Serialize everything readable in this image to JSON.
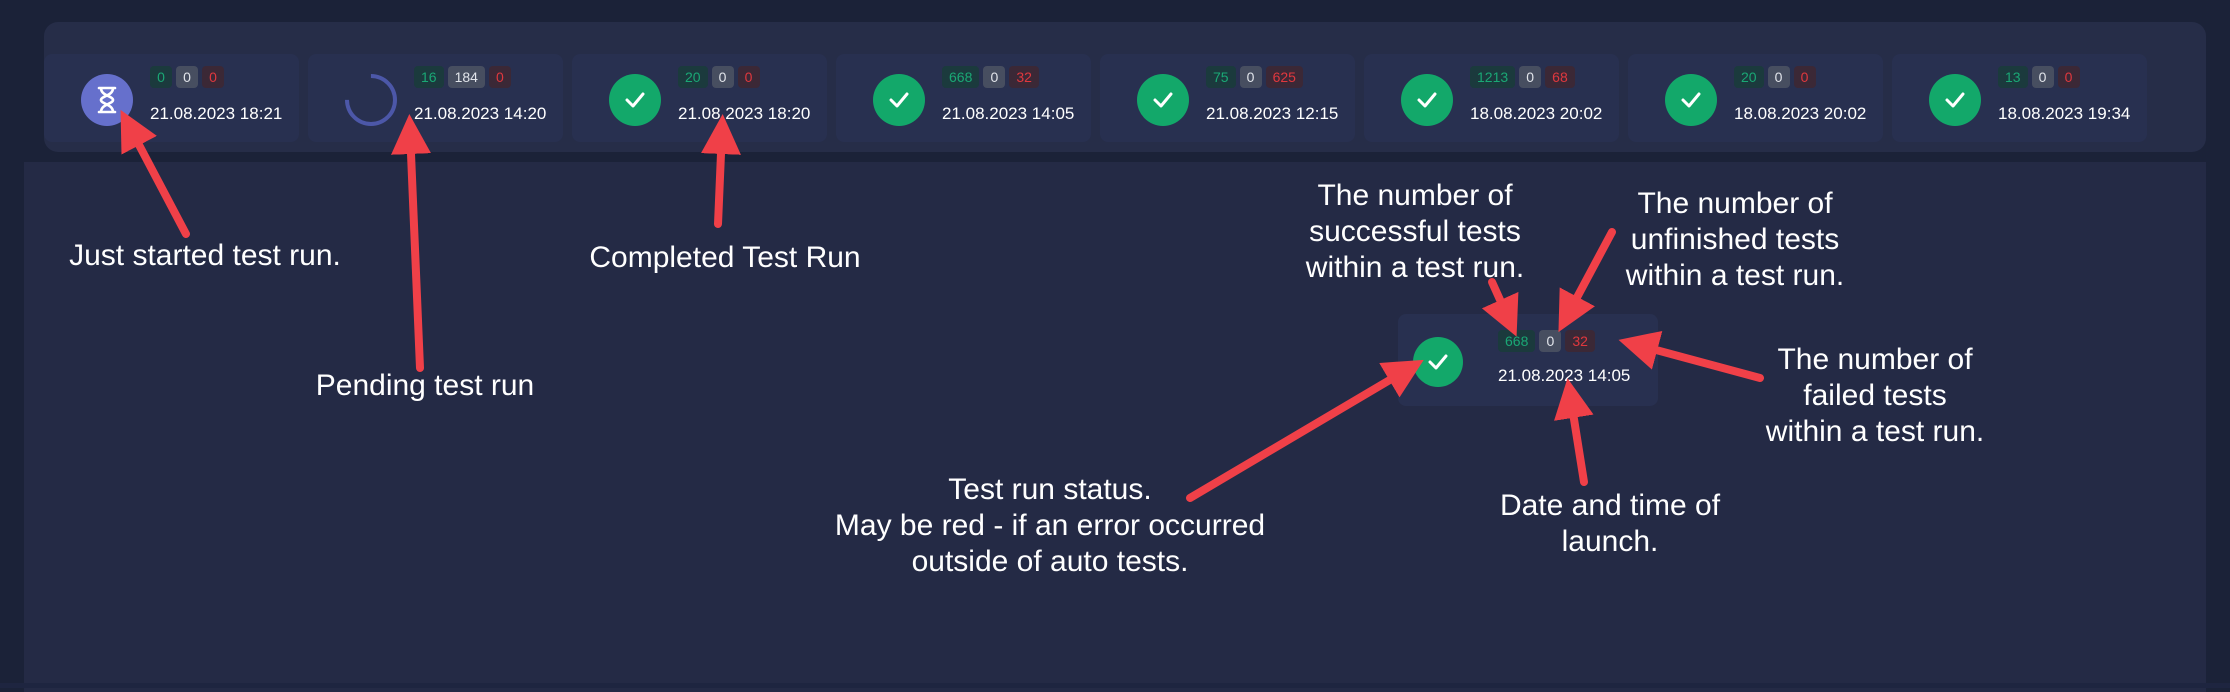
{
  "runs": [
    {
      "status": "started",
      "success": "0",
      "unfinished": "0",
      "failed": "0",
      "date": "21.08.2023 18:21"
    },
    {
      "status": "pending",
      "success": "16",
      "unfinished": "184",
      "failed": "0",
      "date": "21.08.2023 14:20"
    },
    {
      "status": "done",
      "success": "20",
      "unfinished": "0",
      "failed": "0",
      "date": "21.08.2023 18:20"
    },
    {
      "status": "done",
      "success": "668",
      "unfinished": "0",
      "failed": "32",
      "date": "21.08.2023 14:05"
    },
    {
      "status": "done",
      "success": "75",
      "unfinished": "0",
      "failed": "625",
      "date": "21.08.2023 12:15"
    },
    {
      "status": "done",
      "success": "1213",
      "unfinished": "0",
      "failed": "68",
      "date": "18.08.2023 20:02"
    },
    {
      "status": "done",
      "success": "20",
      "unfinished": "0",
      "failed": "0",
      "date": "18.08.2023 20:02"
    },
    {
      "status": "done",
      "success": "13",
      "unfinished": "0",
      "failed": "0",
      "date": "18.08.2023 19:34"
    }
  ],
  "demo": {
    "success": "668",
    "unfinished": "0",
    "failed": "32",
    "date": "21.08.2023 14:05"
  },
  "annotations": {
    "just_started": "Just started test run.",
    "pending": "Pending test run",
    "completed": "Completed Test Run",
    "successful": "The number of\nsuccessful tests\nwithin a test run.",
    "unfinished": "The number of\nunfinished tests\nwithin a test run.",
    "failed": "The number of\nfailed tests\nwithin a test run.",
    "status": "Test run status.\nMay be red - if an error occurred\noutside of auto tests.",
    "datetime": "Date and time of\nlaunch."
  },
  "colors": {
    "success": "#13a86a",
    "started": "#6670cc",
    "arrow": "#f04048",
    "failed": "#e0383e"
  },
  "icons": {
    "started": "hourglass-icon",
    "pending": "spinner-icon",
    "done": "checkmark-icon"
  }
}
